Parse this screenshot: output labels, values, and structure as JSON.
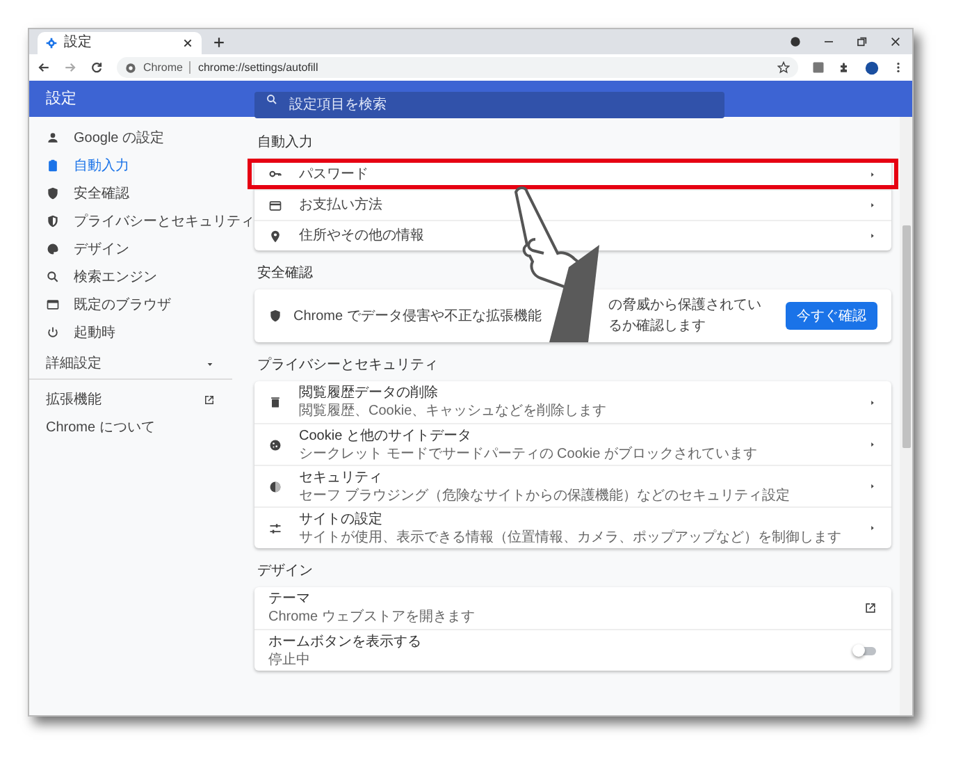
{
  "tab": {
    "title": "設定"
  },
  "address_bar": {
    "site_label": "Chrome",
    "url": "chrome://settings/autofill"
  },
  "header": {
    "title": "設定",
    "search_placeholder": "設定項目を検索"
  },
  "sidebar": {
    "items": [
      {
        "label": "Google の設定",
        "selected": false
      },
      {
        "label": "自動入力",
        "selected": true
      },
      {
        "label": "安全確認",
        "selected": false
      },
      {
        "label": "プライバシーとセキュリティ",
        "selected": false
      },
      {
        "label": "デザイン",
        "selected": false
      },
      {
        "label": "検索エンジン",
        "selected": false
      },
      {
        "label": "既定のブラウザ",
        "selected": false
      },
      {
        "label": "起動時",
        "selected": false
      }
    ],
    "advanced": {
      "label": "詳細設定",
      "expanded": false
    },
    "links": [
      {
        "label": "拡張機能",
        "external": true
      },
      {
        "label": "Chrome について",
        "external": false
      }
    ]
  },
  "autofill": {
    "heading": "自動入力",
    "rows": [
      {
        "label": "パスワード",
        "highlighted": true
      },
      {
        "label": "お支払い方法",
        "highlighted": false
      },
      {
        "label": "住所やその他の情報",
        "highlighted": false
      }
    ]
  },
  "safety_check": {
    "heading": "安全確認",
    "text_before": "Chrome でデータ侵害や不正な拡張機能",
    "text_after": "の脅威から保護されているか確認します",
    "button": "今すぐ確認"
  },
  "privacy": {
    "heading": "プライバシーとセキュリティ",
    "rows": [
      {
        "title": "閲覧履歴データの削除",
        "description": "閲覧履歴、Cookie、キャッシュなどを削除します"
      },
      {
        "title": "Cookie と他のサイトデータ",
        "description": "シークレット モードでサードパーティの Cookie がブロックされています"
      },
      {
        "title": "セキュリティ",
        "description": "セーフ ブラウジング（危険なサイトからの保護機能）などのセキュリティ設定"
      },
      {
        "title": "サイトの設定",
        "description": "サイトが使用、表示できる情報（位置情報、カメラ、ポップアップなど）を制御します"
      }
    ]
  },
  "design": {
    "heading": "デザイン",
    "rows": [
      {
        "kind": "external",
        "title": "テーマ",
        "description": "Chrome ウェブストアを開きます"
      },
      {
        "kind": "toggle",
        "title": "ホームボタンを表示する",
        "description": "停止中",
        "on": false
      }
    ]
  }
}
